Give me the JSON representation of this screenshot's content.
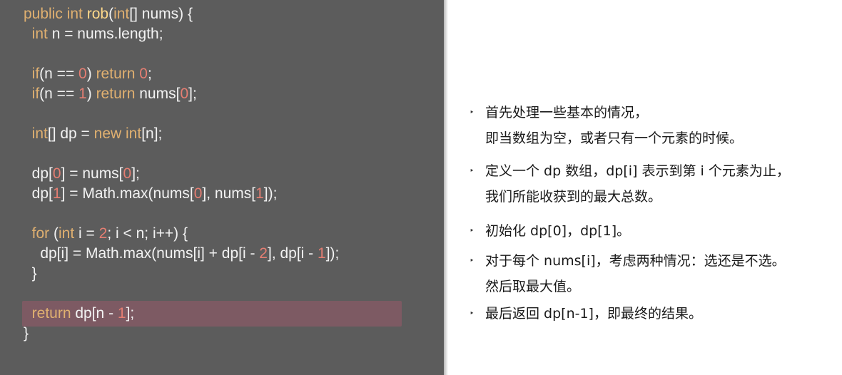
{
  "code": {
    "lines": [
      [
        {
          "t": "public ",
          "c": "kw"
        },
        {
          "t": "int ",
          "c": "kw"
        },
        {
          "t": "rob",
          "c": "fn"
        },
        {
          "t": "(",
          "c": "pl"
        },
        {
          "t": "int",
          "c": "kw"
        },
        {
          "t": "[] nums) {",
          "c": "pl"
        }
      ],
      [
        {
          "t": "  ",
          "c": "pl"
        },
        {
          "t": "int",
          "c": "kw"
        },
        {
          "t": " n = nums.length;",
          "c": "pl"
        }
      ],
      [],
      [
        {
          "t": "  ",
          "c": "pl"
        },
        {
          "t": "if",
          "c": "kw"
        },
        {
          "t": "(n == ",
          "c": "pl"
        },
        {
          "t": "0",
          "c": "num"
        },
        {
          "t": ") ",
          "c": "pl"
        },
        {
          "t": "return ",
          "c": "kw"
        },
        {
          "t": "0",
          "c": "num"
        },
        {
          "t": ";",
          "c": "pl"
        }
      ],
      [
        {
          "t": "  ",
          "c": "pl"
        },
        {
          "t": "if",
          "c": "kw"
        },
        {
          "t": "(n == ",
          "c": "pl"
        },
        {
          "t": "1",
          "c": "num"
        },
        {
          "t": ") ",
          "c": "pl"
        },
        {
          "t": "return",
          "c": "kw"
        },
        {
          "t": " nums[",
          "c": "pl"
        },
        {
          "t": "0",
          "c": "num"
        },
        {
          "t": "];",
          "c": "pl"
        }
      ],
      [],
      [
        {
          "t": "  ",
          "c": "pl"
        },
        {
          "t": "int",
          "c": "kw"
        },
        {
          "t": "[] dp = ",
          "c": "pl"
        },
        {
          "t": "new ",
          "c": "kw"
        },
        {
          "t": "int",
          "c": "kw"
        },
        {
          "t": "[n];",
          "c": "pl"
        }
      ],
      [],
      [
        {
          "t": "  dp[",
          "c": "pl"
        },
        {
          "t": "0",
          "c": "num"
        },
        {
          "t": "] = nums[",
          "c": "pl"
        },
        {
          "t": "0",
          "c": "num"
        },
        {
          "t": "];",
          "c": "pl"
        }
      ],
      [
        {
          "t": "  dp[",
          "c": "pl"
        },
        {
          "t": "1",
          "c": "num"
        },
        {
          "t": "] = Math.max(nums[",
          "c": "pl"
        },
        {
          "t": "0",
          "c": "num"
        },
        {
          "t": "], nums[",
          "c": "pl"
        },
        {
          "t": "1",
          "c": "num"
        },
        {
          "t": "]);",
          "c": "pl"
        }
      ],
      [],
      [
        {
          "t": "  ",
          "c": "pl"
        },
        {
          "t": "for",
          "c": "kw"
        },
        {
          "t": " (",
          "c": "pl"
        },
        {
          "t": "int",
          "c": "kw"
        },
        {
          "t": " i = ",
          "c": "pl"
        },
        {
          "t": "2",
          "c": "num"
        },
        {
          "t": "; i < n; i++) {",
          "c": "pl"
        }
      ],
      [
        {
          "t": "    dp[i] = Math.max(nums[i] + dp[i - ",
          "c": "pl"
        },
        {
          "t": "2",
          "c": "num"
        },
        {
          "t": "], dp[i - ",
          "c": "pl"
        },
        {
          "t": "1",
          "c": "num"
        },
        {
          "t": "]);",
          "c": "pl"
        }
      ],
      [
        {
          "t": "  }",
          "c": "pl"
        }
      ],
      [],
      [
        {
          "t": "  ",
          "c": "pl"
        },
        {
          "t": "return",
          "c": "kw"
        },
        {
          "t": " dp[n - ",
          "c": "pl"
        },
        {
          "t": "1",
          "c": "num"
        },
        {
          "t": "];",
          "c": "pl"
        }
      ],
      [
        {
          "t": "}",
          "c": "pl"
        }
      ]
    ],
    "highlighted_line": 15
  },
  "bullets": [
    {
      "marker": "‣",
      "lines": [
        "首先处理一些基本的情况，",
        "即当数组为空，或者只有一个元素的时候。"
      ]
    },
    {
      "marker": "‣",
      "lines": [
        "定义一个 dp 数组，dp[i] 表示到第 i 个元素为止，",
        "我们所能收获到的最大总数。"
      ]
    },
    {
      "marker": "‣",
      "lines": [
        "初始化 dp[0]，dp[1]。"
      ]
    },
    {
      "marker": "‣",
      "lines": [
        "对于每个 nums[i]，考虑两种情况：选还是不选。",
        "然后取最大值。"
      ]
    },
    {
      "marker": "‣",
      "lines": [
        "最后返回 dp[n-1]，即最终的结果。"
      ]
    }
  ],
  "colors": {
    "code_background": "#5c5c5c",
    "highlight": "#7d5a63",
    "keyword": "#e0b070",
    "function_name": "#ffd98a",
    "number": "#e57e72",
    "plain_text": "#f2f2f2"
  }
}
